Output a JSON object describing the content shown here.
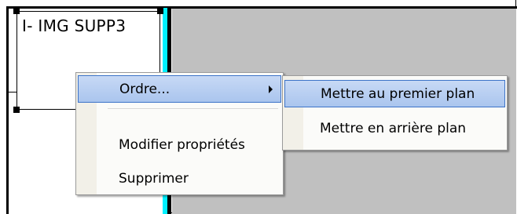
{
  "shape": {
    "title": "I- IMG SUPP3"
  },
  "context_menu": {
    "items": [
      {
        "label": "Ordre...",
        "highlighted": true,
        "has_submenu": true
      },
      {
        "label": "Modifier propriétés"
      },
      {
        "label": "Supprimer"
      }
    ]
  },
  "submenu": {
    "items": [
      {
        "label": "Mettre au premier plan",
        "highlighted": true
      },
      {
        "label": "Mettre en arrière plan"
      }
    ]
  },
  "colors": {
    "highlight_fill": "#b9cff2",
    "highlight_border": "#3c73c8",
    "workspace_gray": "#c0c0c0",
    "selection_cyan": "#00f0ff"
  }
}
